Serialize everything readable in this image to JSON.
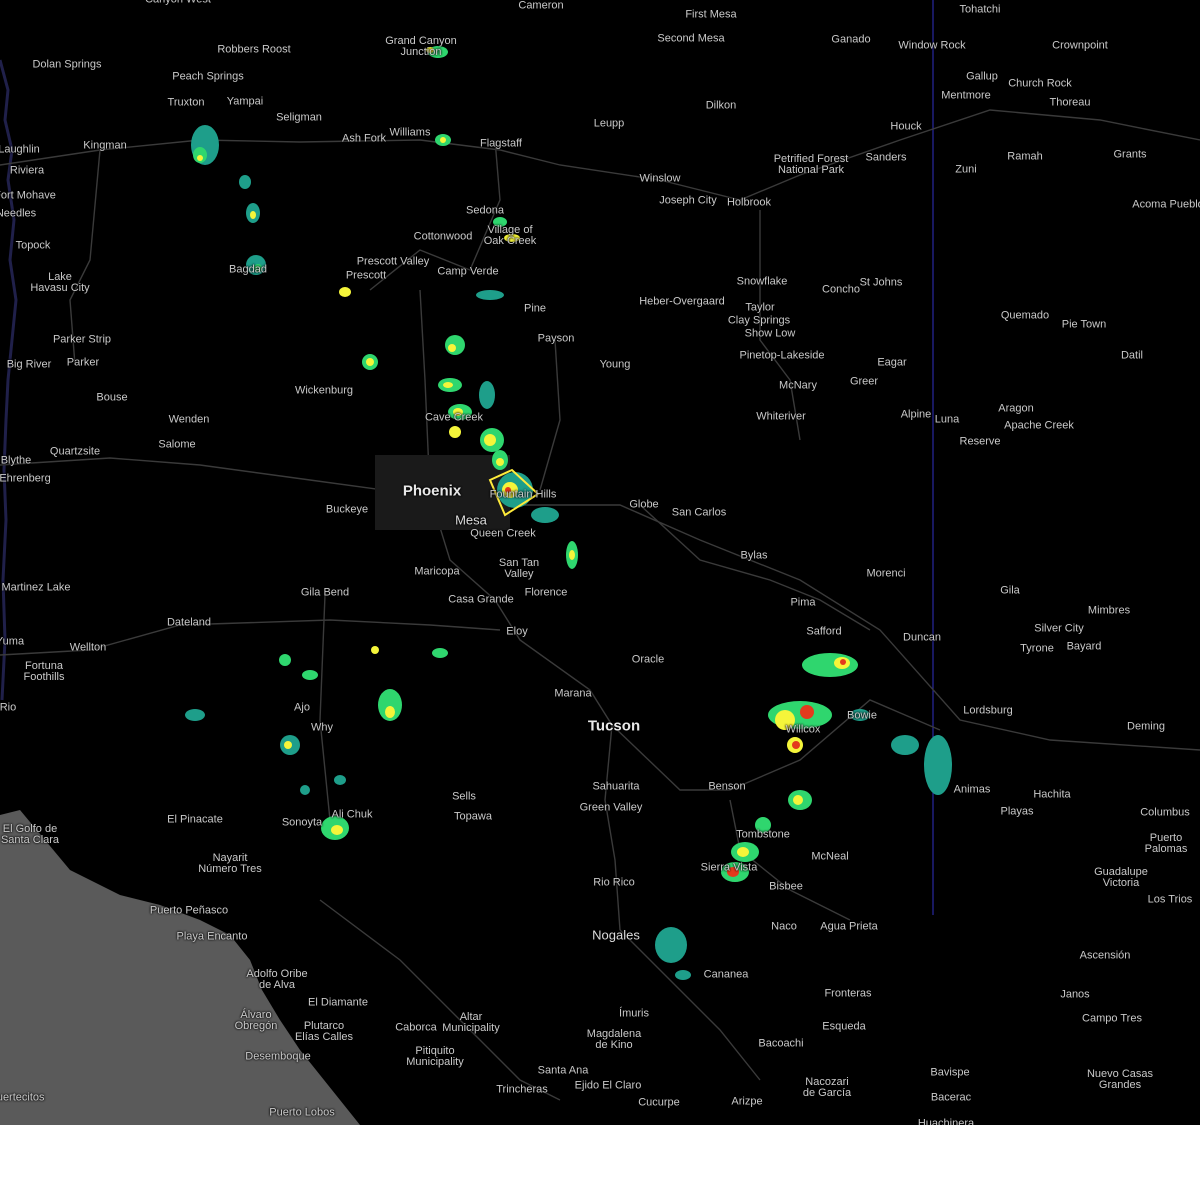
{
  "map": {
    "colors": {
      "background": "#000000",
      "ocean": "#5a5a5a",
      "roads": "#3a3a3a",
      "border": "#2f2fbf",
      "rivers": "#20204a",
      "warning_polygon": "#ffeb3b",
      "radar_light": "#1e9e8a",
      "radar_medium": "#2fd66e",
      "radar_heavy": "#f5f53a",
      "radar_intense": "#e33a1d"
    },
    "labels": {
      "cameron": "Cameron",
      "tohatchi": "Tohatchi",
      "canyon_west": "Canyon West",
      "first_mesa": "First Mesa",
      "second_mesa": "Second Mesa",
      "ganado": "Ganado",
      "window_rock": "Window Rock",
      "crownpoint": "Crownpoint",
      "grand_canyon_junction": "Grand Canyon\nJunction",
      "robbers_roost": "Robbers Roost",
      "dolan_springs": "Dolan Springs",
      "peach_springs": "Peach Springs",
      "truxton": "Truxton",
      "yampai": "Yampai",
      "seligman": "Seligman",
      "gallup": "Gallup",
      "church_rock": "Church Rock",
      "mentmore": "Mentmore",
      "thoreau": "Thoreau",
      "dilkon": "Dilkon",
      "leupp": "Leupp",
      "ash_fork": "Ash Fork",
      "williams": "Williams",
      "flagstaff": "Flagstaff",
      "kingman": "Kingman",
      "laughlin": "Laughlin",
      "riviera": "Riviera",
      "fort_mohave": "Fort Mohave",
      "needles": "Needles",
      "houck": "Houck",
      "sanders": "Sanders",
      "grants": "Grants",
      "ramah": "Ramah",
      "petrified_forest": "Petrified Forest\nNational Park",
      "zuni": "Zuni",
      "acoma_pueblo": "Acoma Pueblo",
      "winslow": "Winslow",
      "joseph_city": "Joseph City",
      "holbrook": "Holbrook",
      "sedona": "Sedona",
      "village_of_oak_creek": "Village of\nOak Creek",
      "topock": "Topock",
      "cottonwood": "Cottonwood",
      "prescott_valley": "Prescott Valley",
      "bagdad": "Bagdad",
      "lake_havasu_city": "Lake\nHavasu City",
      "prescott": "Prescott",
      "camp_verde": "Camp Verde",
      "snowflake": "Snowflake",
      "concho": "Concho",
      "st_johns": "St Johns",
      "pine": "Pine",
      "heber_overgaard": "Heber-Overgaard",
      "taylor": "Taylor",
      "clay_springs": "Clay Springs",
      "quemado": "Quemado",
      "pie_town": "Pie Town",
      "show_low": "Show Low",
      "parker_strip": "Parker Strip",
      "payson": "Payson",
      "datil": "Datil",
      "pinetop_lakeside": "Pinetop-Lakeside",
      "eagar": "Eagar",
      "big_river": "Big River",
      "parker": "Parker",
      "young": "Young",
      "mcnary": "McNary",
      "greer": "Greer",
      "wickenburg": "Wickenburg",
      "bouse": "Bouse",
      "aragon": "Aragon",
      "whiteriver": "Whiteriver",
      "alpine": "Alpine",
      "luna": "Luna",
      "wenden": "Wenden",
      "cave_creek": "Cave Creek",
      "apache_creek": "Apache Creek",
      "reserve": "Reserve",
      "salome": "Salome",
      "quartzsite": "Quartzsite",
      "blythe": "Blythe",
      "ehrenberg": "Ehrenberg",
      "phoenix": "Phoenix",
      "fountain_hills": "Fountain Hills",
      "buckeye": "Buckeye",
      "globe": "Globe",
      "mesa": "Mesa",
      "san_carlos": "San Carlos",
      "queen_creek": "Queen Creek",
      "bylas": "Bylas",
      "san_tan_valley": "San Tan\nValley",
      "maricopa": "Maricopa",
      "morenci": "Morenci",
      "martinez_lake": "Martinez Lake",
      "florence": "Florence",
      "gila_bend": "Gila Bend",
      "gila": "Gila",
      "casa_grande": "Casa Grande",
      "pima": "Pima",
      "mimbres": "Mimbres",
      "dateland": "Dateland",
      "safford": "Safford",
      "silver_city": "Silver City",
      "eloy": "Eloy",
      "duncan": "Duncan",
      "yuma": "Yuma",
      "wellton": "Wellton",
      "tyrone": "Tyrone",
      "bayard": "Bayard",
      "fortuna_foothills": "Fortuna\nFoothills",
      "oracle": "Oracle",
      "marana": "Marana",
      "rio": "Rio",
      "ajo": "Ajo",
      "bowie": "Bowie",
      "lordsburg": "Lordsburg",
      "tucson": "Tucson",
      "why": "Why",
      "willcox": "Willcox",
      "deming": "Deming",
      "sahuarita": "Sahuarita",
      "benson": "Benson",
      "animas": "Animas",
      "hachita": "Hachita",
      "sells": "Sells",
      "green_valley": "Green Valley",
      "playas": "Playas",
      "el_pinacate": "El Pinacate",
      "ali_chuk": "Ali Chuk",
      "topawa": "Topawa",
      "columbus": "Columbus",
      "el_golfo": "El Golfo de\nSanta Clara",
      "sonoyta": "Sonoyta",
      "tombstone": "Tombstone",
      "puerto_palomas": "Puerto\nPalomas",
      "mcneal": "McNeal",
      "sierra_vista": "Sierra Vista",
      "nayarit": "Nayarit\nNúmero Tres",
      "guadalupe_victoria": "Guadalupe\nVictoria",
      "rio_rico": "Rio Rico",
      "bisbee": "Bisbee",
      "los_trios": "Los Trios",
      "puerto_penasco": "Puerto Peñasco",
      "playa_encanto": "Playa Encanto",
      "nogales": "Nogales",
      "naco": "Naco",
      "agua_prieta": "Agua Prieta",
      "ascension": "Ascensión",
      "cananea": "Cananea",
      "adolfo_oribe": "Adolfo Oribe\nde Alva",
      "janos": "Janos",
      "fronteras": "Fronteras",
      "el_diamante": "El Diamante",
      "altar_municipality": "Altar\nMunicipality",
      "imuris": "Ímuris",
      "campo_tres": "Campo Tres",
      "alvaro_obregon": "Álvaro\nObregón",
      "plutarco": "Plutarco\nElías Calles",
      "caborca": "Caborca",
      "esquedа": "Esqueda",
      "magdalena": "Magdalena\nde Kino",
      "pitiquito": "Pitiquito\nMunicipality",
      "bacoachi": "Bacoachi",
      "desemboque": "Desemboque",
      "nuevo_casas_grandes": "Nuevo Casas\nGrandes",
      "santa_ana": "Santa Ana",
      "ejido_el_claro": "Ejido El Claro",
      "bavispe": "Bavispe",
      "trincheras": "Trincheras",
      "nacozari": "Nacozari\nde García",
      "puertecitos": "Puertecitos",
      "cucurpe": "Cucurpe",
      "arizpe": "Arizpe",
      "bacerac": "Bacerac",
      "puerto_lobos": "Puerto Lobos",
      "huachinera": "Huachinera"
    }
  }
}
